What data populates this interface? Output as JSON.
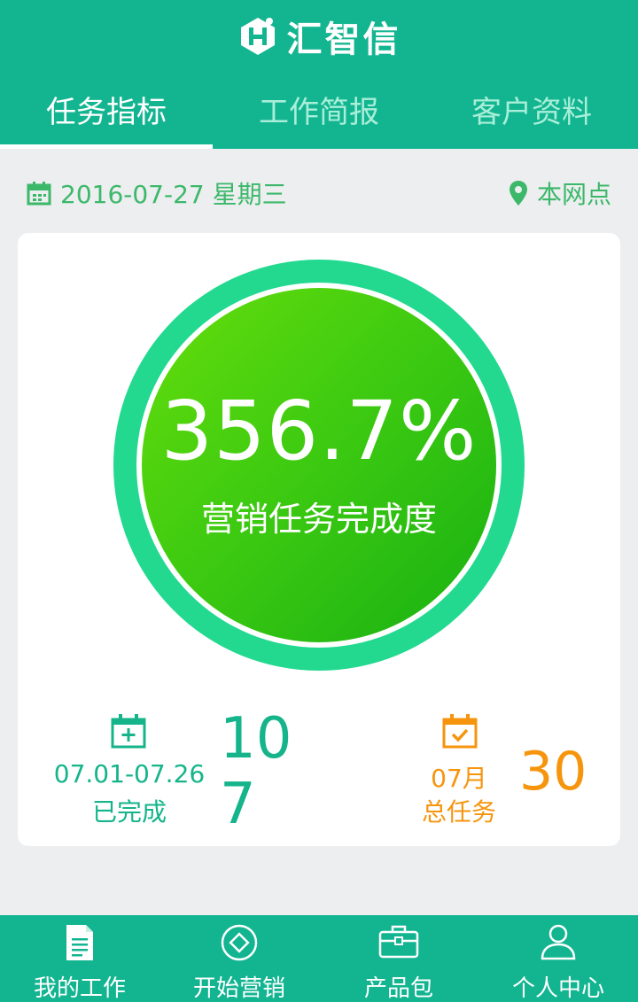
{
  "app": {
    "title": "汇智信"
  },
  "tabs": [
    {
      "label": "任务指标",
      "active": true
    },
    {
      "label": "工作简报",
      "active": false
    },
    {
      "label": "客户资料",
      "active": false
    }
  ],
  "info": {
    "date": "2016-07-27 星期三",
    "branch": "本网点"
  },
  "progress": {
    "value_text": "356.7%",
    "value": 356.7,
    "label": "营销任务完成度"
  },
  "stats": {
    "completed": {
      "period": "07.01-07.26",
      "label": "已完成",
      "value": "107"
    },
    "total": {
      "period": "07月",
      "label": "总任务",
      "value": "30"
    }
  },
  "bottom_nav": [
    {
      "label": "我的工作",
      "icon": "document-icon"
    },
    {
      "label": "开始营销",
      "icon": "diamond-circle-icon"
    },
    {
      "label": "产品包",
      "icon": "briefcase-icon"
    },
    {
      "label": "个人中心",
      "icon": "user-icon"
    }
  ],
  "colors": {
    "primary": "#13b591",
    "accent_green": "#3cb86a",
    "ring": "#22d98f",
    "orange": "#f6950d"
  }
}
